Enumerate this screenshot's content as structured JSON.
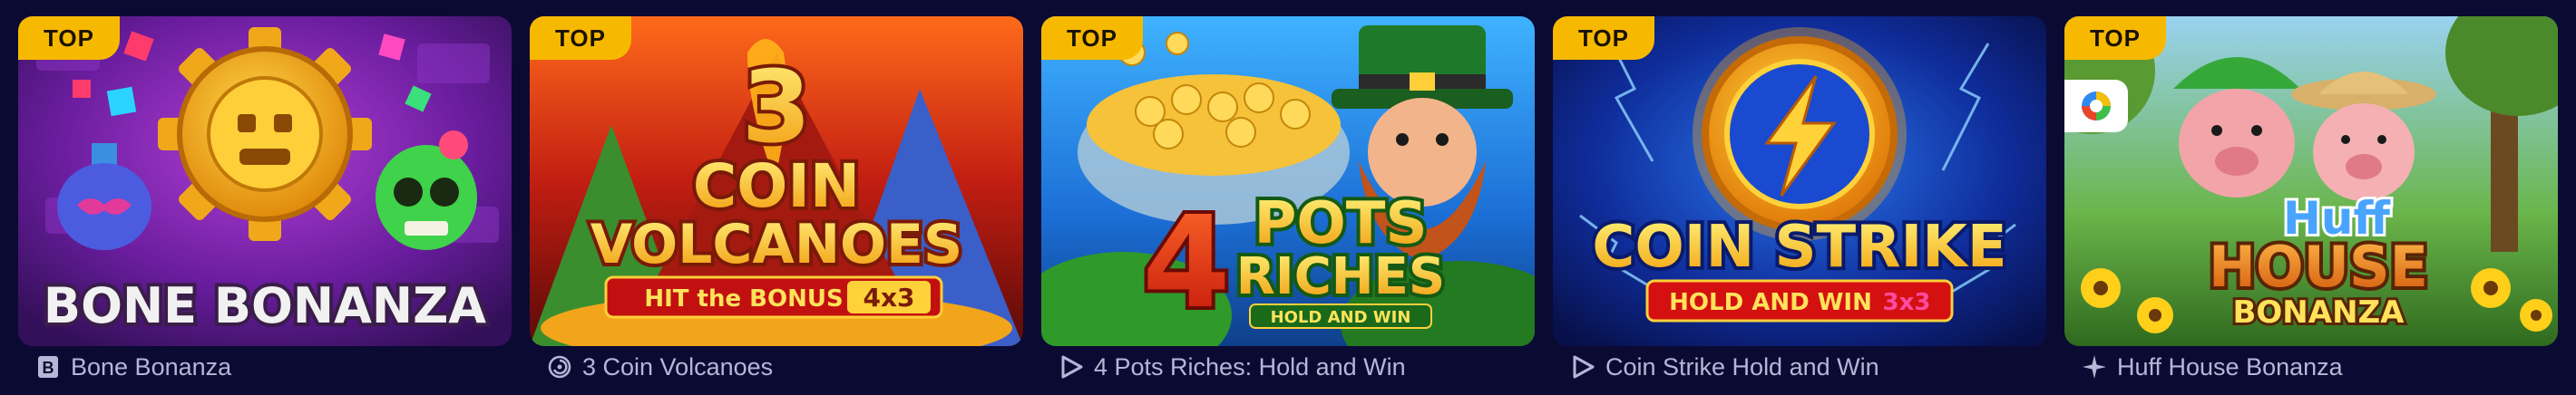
{
  "badge_label": "TOP",
  "colors": {
    "background": "#0b0a33",
    "badge": "#f7b900",
    "caption_text": "#b7b6d6"
  },
  "games": [
    {
      "title": "Bone Bonanza",
      "art_title": "BONE BONANZA",
      "provider_icon": "b-square-icon",
      "badge": "TOP"
    },
    {
      "title": "3 Coin Volcanoes",
      "art_title_number": "3",
      "art_title_line1": "COIN",
      "art_title_line2": "VOLCANOES",
      "art_subtitle": "HIT the BONUS",
      "art_tag": "4x3",
      "provider_icon": "spiral-coin-icon",
      "badge": "TOP"
    },
    {
      "title": "4 Pots Riches: Hold and Win",
      "art_title_number": "4",
      "art_title_line1": "POTS",
      "art_title_line2": "RICHES",
      "art_subtitle": "HOLD AND WIN",
      "provider_icon": "play-arrow-icon",
      "badge": "TOP"
    },
    {
      "title": "Coin Strike Hold and Win",
      "art_title_line1": "COIN STRIKE",
      "art_subtitle": "HOLD AND WIN",
      "art_tag": "3x3",
      "provider_icon": "play-arrow-icon",
      "badge": "TOP"
    },
    {
      "title": "Huff House Bonanza",
      "art_title_line1": "Huff",
      "art_title_line2": "HOUSE",
      "art_title_line3": "BONANZA",
      "provider_icon": "star-burst-icon",
      "provider_chip_icon": "colorful-circle-icon",
      "badge": "TOP"
    }
  ]
}
